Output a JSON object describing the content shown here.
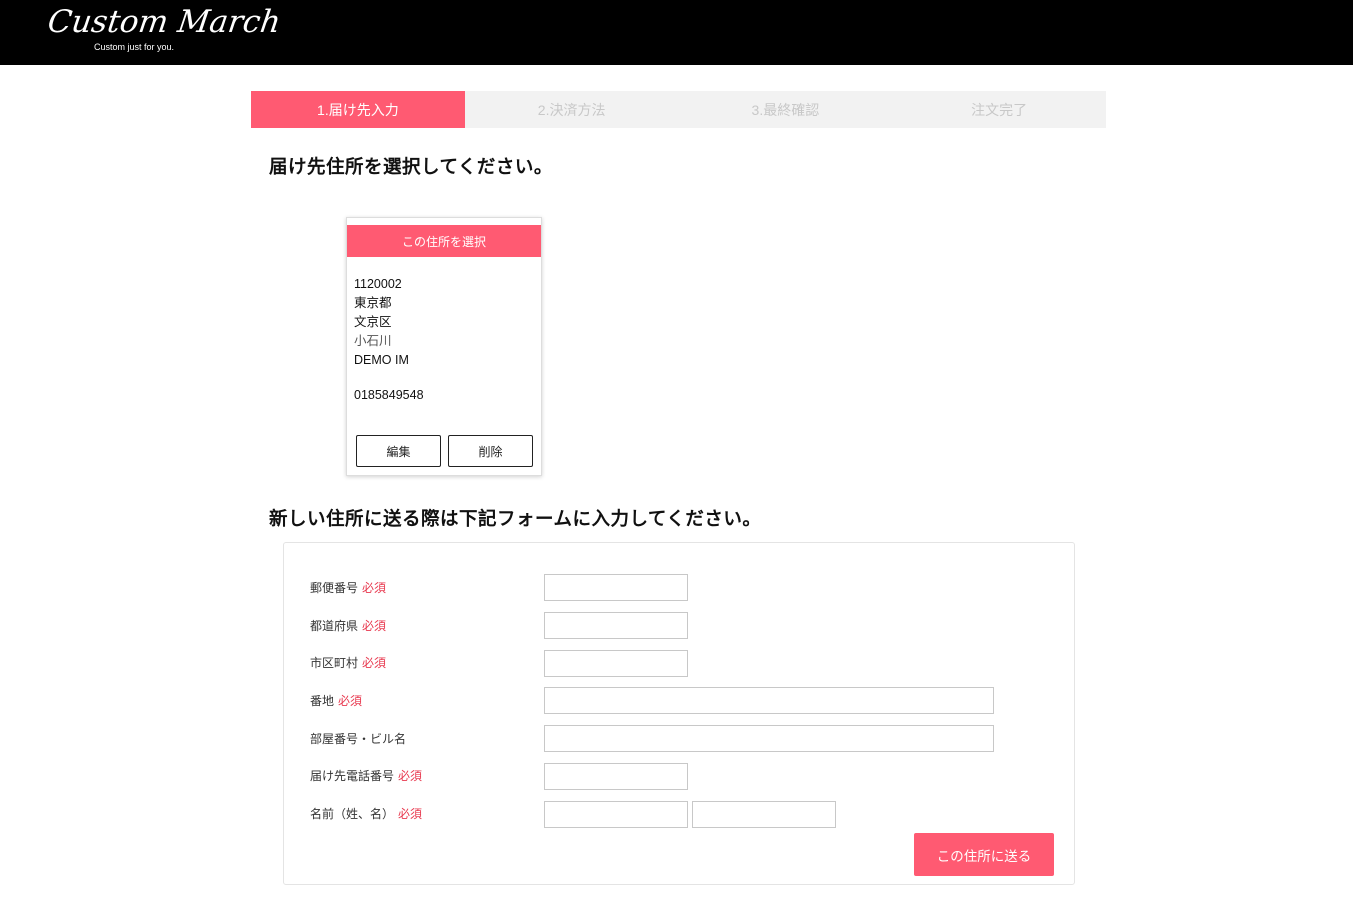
{
  "header": {
    "logo_text": "Custom March",
    "tagline": "Custom just for you."
  },
  "steps": [
    {
      "label": "1.届け先入力",
      "active": true
    },
    {
      "label": "2.決済方法",
      "active": false
    },
    {
      "label": "3.最終確認",
      "active": false
    },
    {
      "label": "注文完了",
      "active": false
    }
  ],
  "select_heading": "届け先住所を選択してください。",
  "address_card": {
    "select_label": "この住所を選択",
    "postal_code": "1120002",
    "prefecture": "東京都",
    "city": "文京区",
    "street": "小石川",
    "name": "DEMO IM",
    "phone": "0185849548",
    "edit_label": "編集",
    "delete_label": "削除"
  },
  "new_address_heading": "新しい住所に送る際は下記フォームに入力してください。",
  "form": {
    "required_mark": "必須",
    "fields": {
      "postal_code": {
        "label": "郵便番号",
        "value": ""
      },
      "prefecture": {
        "label": "都道府県",
        "value": ""
      },
      "city": {
        "label": "市区町村",
        "value": ""
      },
      "street": {
        "label": "番地",
        "value": ""
      },
      "building": {
        "label": "部屋番号・ビル名",
        "value": ""
      },
      "phone": {
        "label": "届け先電話番号",
        "value": ""
      },
      "name": {
        "label": "名前（姓、名）",
        "last_value": "",
        "first_value": ""
      }
    },
    "submit_label": "この住所に送る"
  },
  "colors": {
    "accent": "#ff5a72",
    "required": "#e8394f",
    "header_bg": "#000000",
    "step_inactive_bg": "#f2f2f2"
  }
}
